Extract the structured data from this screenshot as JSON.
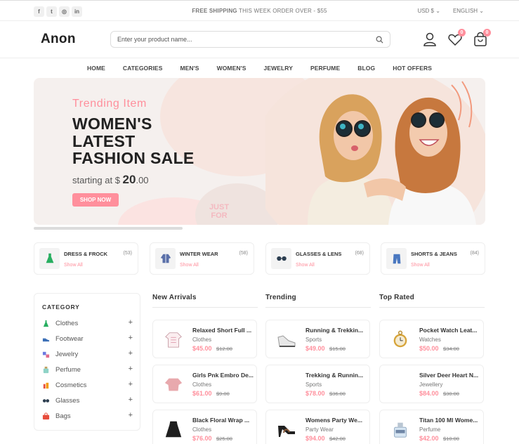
{
  "topbar": {
    "social": [
      {
        "icon": "facebook-icon",
        "glyph": "f"
      },
      {
        "icon": "twitter-icon",
        "glyph": "t"
      },
      {
        "icon": "instagram-icon",
        "glyph": "◎"
      },
      {
        "icon": "linkedin-icon",
        "glyph": "in"
      }
    ],
    "shipping_bold": "FREE SHIPPING",
    "shipping_rest": " THIS WEEK ORDER OVER - $55",
    "currency": "USD $",
    "language": "ENGLISH"
  },
  "header": {
    "logo": "Anon",
    "search_placeholder": "Enter your product name...",
    "wishlist_count": "0",
    "cart_count": "0"
  },
  "nav": [
    "HOME",
    "CATEGORIES",
    "MEN'S",
    "WOMEN'S",
    "JEWELRY",
    "PERFUME",
    "BLOG",
    "HOT OFFERS"
  ],
  "banner": {
    "subtitle": "Trending Item",
    "title": "WOMEN'S LATEST FASHION SALE",
    "price_prefix": "starting at $ ",
    "price_main": "20",
    "price_cents": ".00",
    "button": "SHOP NOW",
    "watermark": "JUST FOR"
  },
  "categories": [
    {
      "name": "DRESS & FROCK",
      "count": "(53)",
      "show": "Show All",
      "icon": "dress-icon"
    },
    {
      "name": "WINTER WEAR",
      "count": "(58)",
      "show": "Show All",
      "icon": "jacket-icon"
    },
    {
      "name": "GLASSES & LENS",
      "count": "(68)",
      "show": "Show All",
      "icon": "glasses-icon"
    },
    {
      "name": "SHORTS & JEANS",
      "count": "(84)",
      "show": "Show All",
      "icon": "jeans-icon"
    }
  ],
  "sidebar": {
    "title": "CATEGORY",
    "items": [
      {
        "label": "Clothes",
        "icon": "dress-icon"
      },
      {
        "label": "Footwear",
        "icon": "shoe-icon"
      },
      {
        "label": "Jewelry",
        "icon": "jewelry-icon"
      },
      {
        "label": "Perfume",
        "icon": "perfume-icon"
      },
      {
        "label": "Cosmetics",
        "icon": "cosmetics-icon"
      },
      {
        "label": "Glasses",
        "icon": "glasses-icon"
      },
      {
        "label": "Bags",
        "icon": "bag-icon"
      }
    ]
  },
  "columns": [
    {
      "title": "New Arrivals",
      "products": [
        {
          "name": "Relaxed Short Full ...",
          "category": "Clothes",
          "price": "$45.00",
          "old": "$12.00",
          "icon": "shirt-icon"
        },
        {
          "name": "Girls Pnk Embro De...",
          "category": "Clothes",
          "price": "$61.00",
          "old": "$9.00",
          "icon": "top-icon"
        },
        {
          "name": "Black Floral Wrap ...",
          "category": "Clothes",
          "price": "$76.00",
          "old": "$25.00",
          "icon": "skirt-icon"
        }
      ]
    },
    {
      "title": "Trending",
      "products": [
        {
          "name": "Running & Trekkin...",
          "category": "Sports",
          "price": "$49.00",
          "old": "$15.00",
          "icon": "sneaker-icon"
        },
        {
          "name": "Trekking & Runnin...",
          "category": "Sports",
          "price": "$78.00",
          "old": "$36.00",
          "icon": "boot-icon"
        },
        {
          "name": "Womens Party We...",
          "category": "Party Wear",
          "price": "$94.00",
          "old": "$42.00",
          "icon": "heels-icon"
        }
      ]
    },
    {
      "title": "Top Rated",
      "products": [
        {
          "name": "Pocket Watch Leat...",
          "category": "Watches",
          "price": "$50.00",
          "old": "$34.00",
          "icon": "pocket-watch-icon"
        },
        {
          "name": "Silver Deer Heart N...",
          "category": "Jewellery",
          "price": "$84.00",
          "old": "$30.00",
          "icon": "necklace-icon"
        },
        {
          "name": "Titan 100 Ml Wome...",
          "category": "Perfume",
          "price": "$42.00",
          "old": "$10.00",
          "icon": "perfume-icon"
        }
      ]
    }
  ],
  "colors": {
    "accent": "#ff8f9c",
    "text": "#212121",
    "border": "#eeeeee"
  }
}
